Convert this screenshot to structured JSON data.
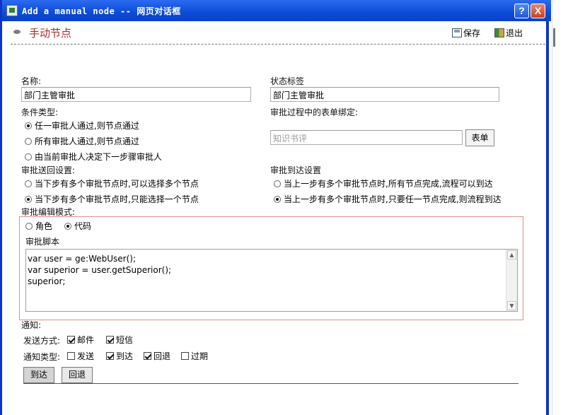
{
  "window": {
    "title": "Add a manual node -- 网页对话框",
    "help_label": "?",
    "close_label": "X"
  },
  "header": {
    "title": "手动节点",
    "save_label": "保存",
    "exit_label": "退出"
  },
  "form": {
    "name_label": "名称:",
    "name_value": "部门主管审批",
    "status_label": "状态标签",
    "status_value": "部门主管审批",
    "condition_label": "条件类型:",
    "condition_options": [
      {
        "label": "任一审批人通过,则节点通过",
        "checked": true
      },
      {
        "label": "所有审批人通过,则节点通过",
        "checked": false
      },
      {
        "label": "由当前审批人决定下一步骤审批人",
        "checked": false
      }
    ],
    "form_binding_label": "审批过程中的表单绑定:",
    "form_placeholder": "知识书评",
    "form_button": "表单",
    "goto_label": "审批送回设置:",
    "goto_options": [
      {
        "label": "当下步有多个审批节点时,可以选择多个节点",
        "checked": false
      },
      {
        "label": "当下步有多个审批节点时,只能选择一个节点",
        "checked": true
      }
    ],
    "arrive_label": "审批到达设置",
    "arrive_options": [
      {
        "label": "当上一步有多个审批节点时,所有节点完成,流程可以到达",
        "checked": false
      },
      {
        "label": "当上一步有多个审批节点时,只要任一节点完成,则流程到达",
        "checked": true
      }
    ],
    "edit_mode_label": "审批编辑模式:",
    "mode_options": [
      {
        "label": "角色",
        "checked": false
      },
      {
        "label": "代码",
        "checked": true
      }
    ],
    "script_label": "审批脚本",
    "script_lines": [
      "var user = ge:WebUser();",
      "var superior = user.getSuperior();",
      "superior;"
    ]
  },
  "notify": {
    "title": "通知:",
    "send_label": "发送方式:",
    "send_options": [
      {
        "label": "邮件",
        "checked": true
      },
      {
        "label": "短信",
        "checked": true
      }
    ],
    "type_label": "通知类型:",
    "type_options": [
      {
        "label": "发送",
        "checked": false
      },
      {
        "label": "到达",
        "checked": true
      },
      {
        "label": "回退",
        "checked": true
      },
      {
        "label": "过期",
        "checked": false
      }
    ]
  },
  "tabs": [
    {
      "label": "到达",
      "active": true
    },
    {
      "label": "回退",
      "active": false
    }
  ]
}
